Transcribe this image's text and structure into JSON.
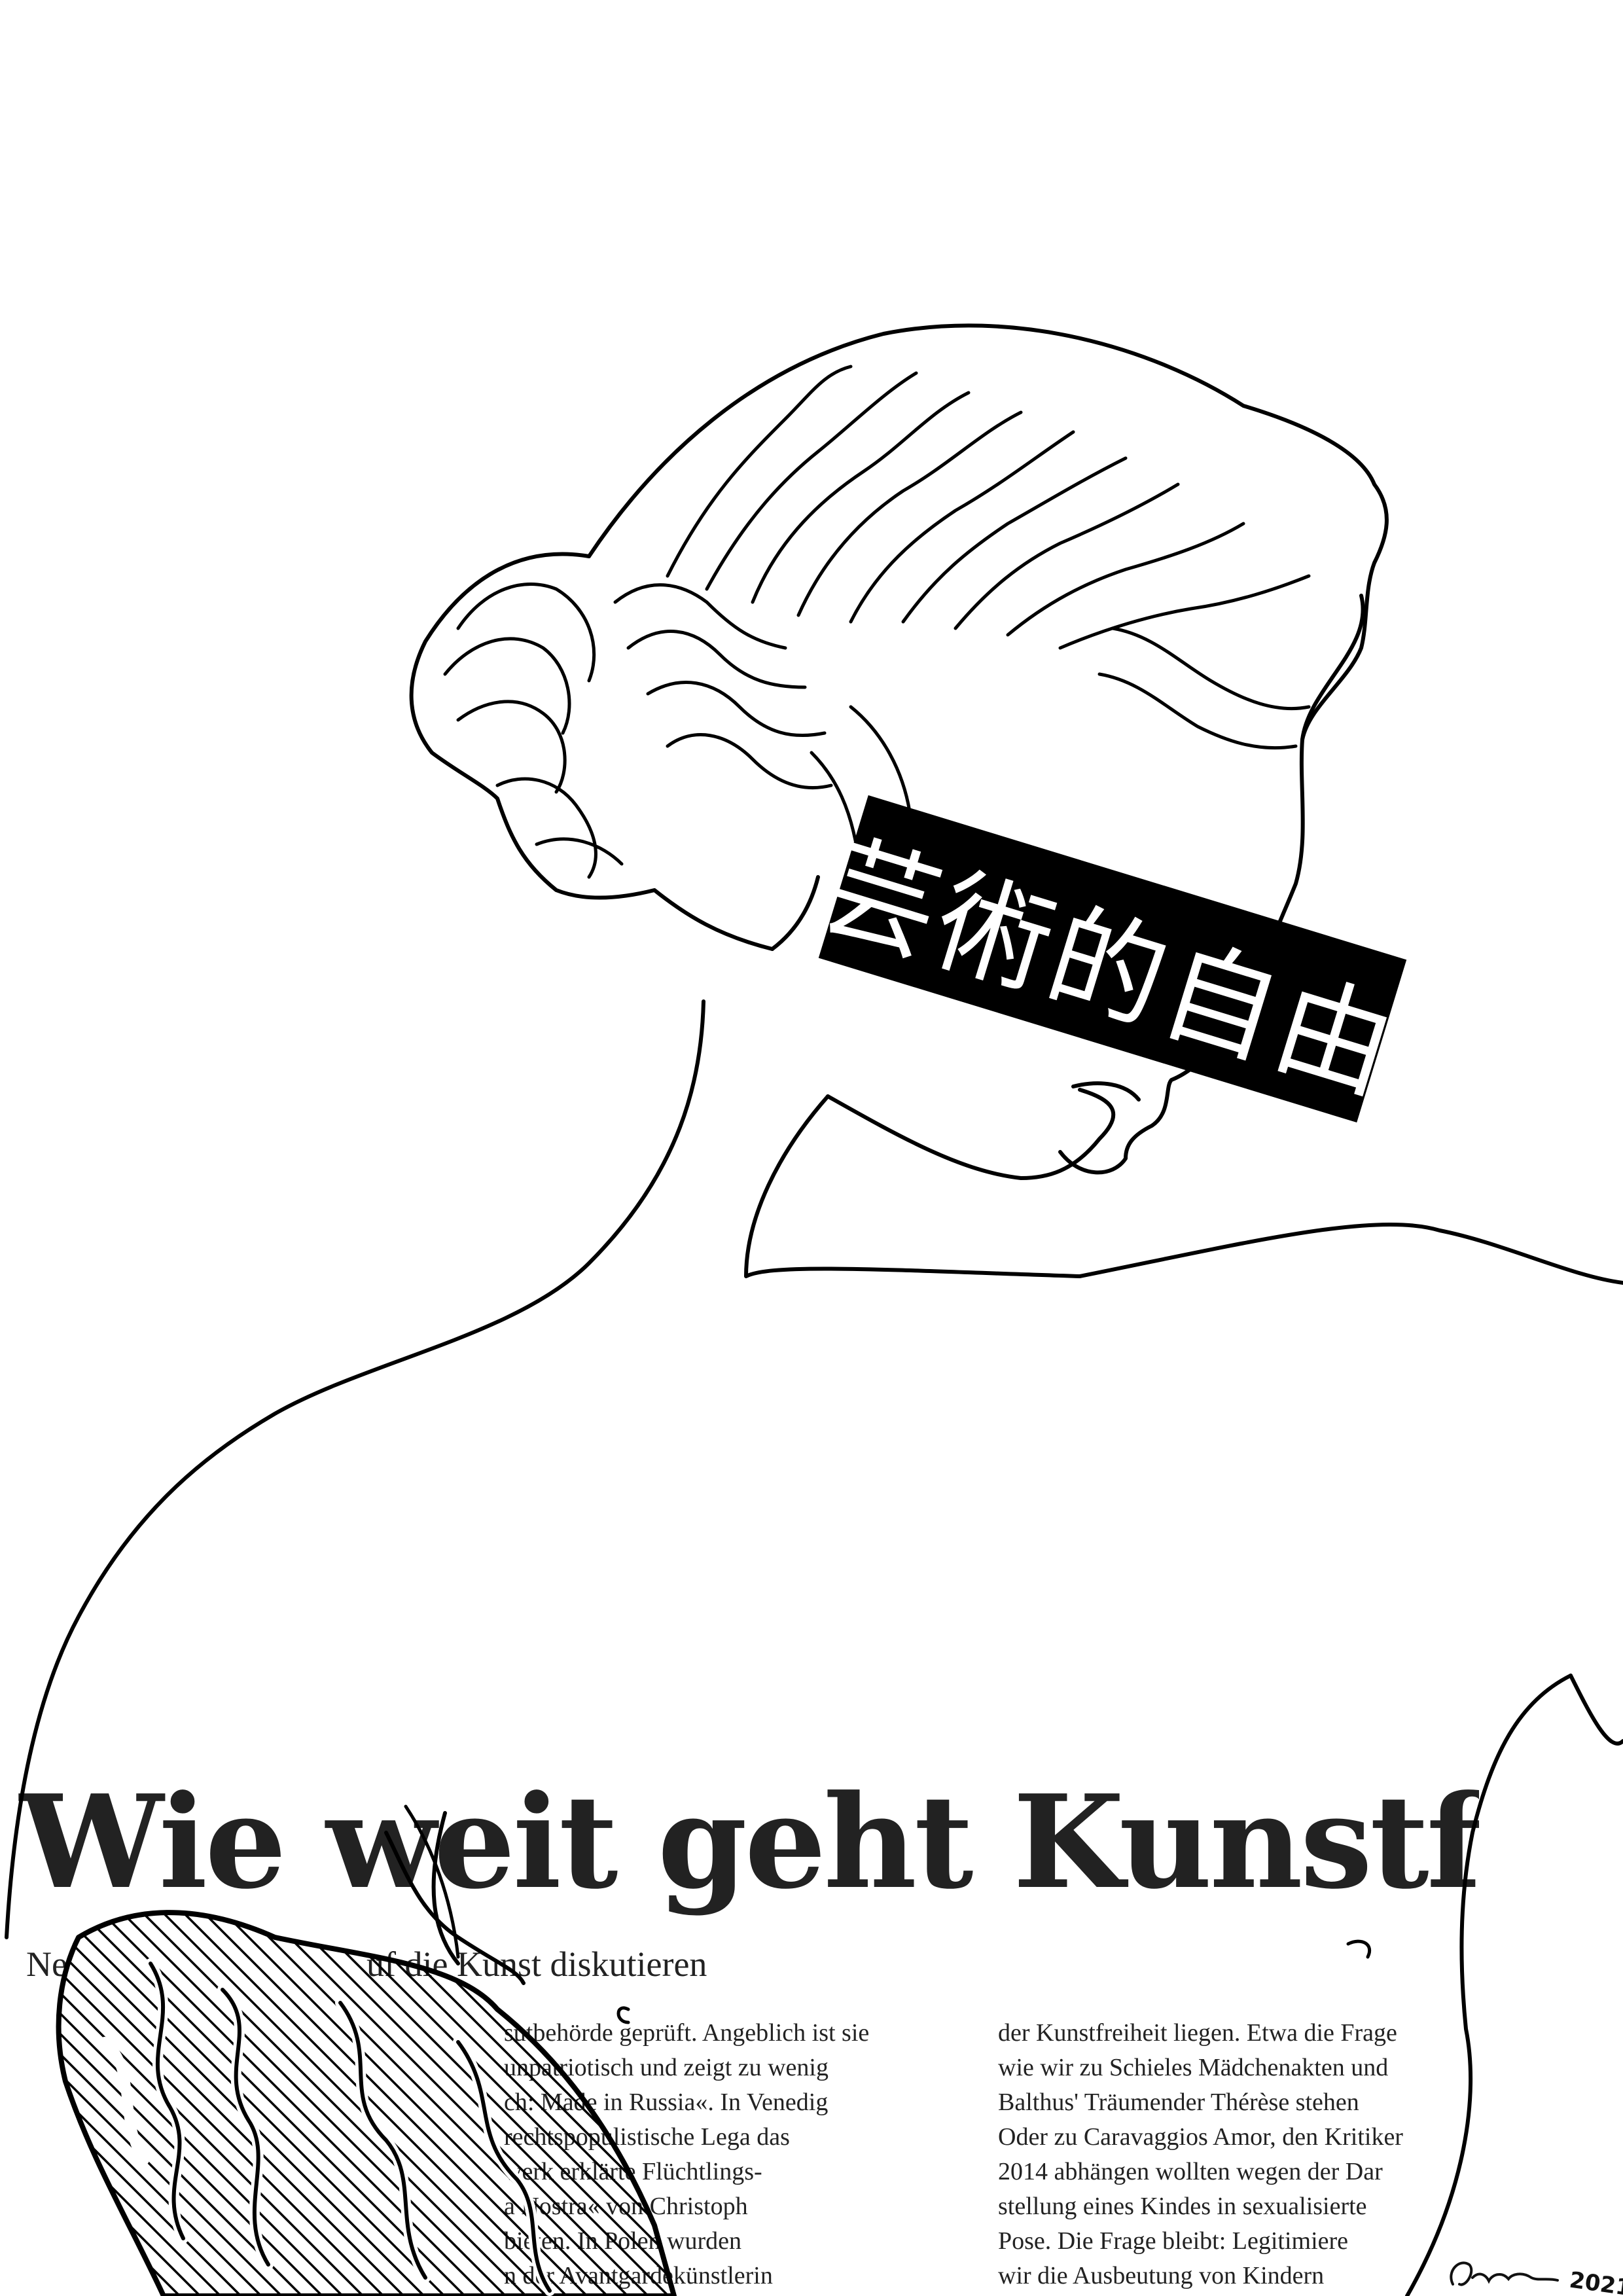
{
  "artwork": {
    "censor_text": "芸術的自由",
    "signature": "2021"
  },
  "newspaper": {
    "headline": "Wie weit geht Kunstfreihei",
    "subline_left": "Ne",
    "subline_right": "uf die Kunst diskutieren",
    "column1": [
      "sutbehörde geprüft. Angeblich ist sie",
      "unpatriotisch und zeigt zu wenig",
      "ch: Made in Russia«. In Venedig",
      "rechtspopulistische Lega das",
      "werk erklärte Flüchtlings-",
      "a Nostra« von Christoph",
      "bieten. In Polen wurden",
      "n der Avantgardekünstlerin"
    ],
    "column2": [
      "der Kunstfreiheit liegen. Etwa die Frage",
      "wie wir zu Schieles Mädchenakten und",
      "Balthus' Träumender Thérèse stehen",
      "Oder zu Caravaggios Amor, den Kritiker",
      "2014 abhängen wollten wegen der Dar",
      "stellung eines Kindes in sexualisierte",
      "Pose. Die Frage bleibt: Legitimiere",
      "wir die Ausbeutung von Kindern"
    ]
  }
}
